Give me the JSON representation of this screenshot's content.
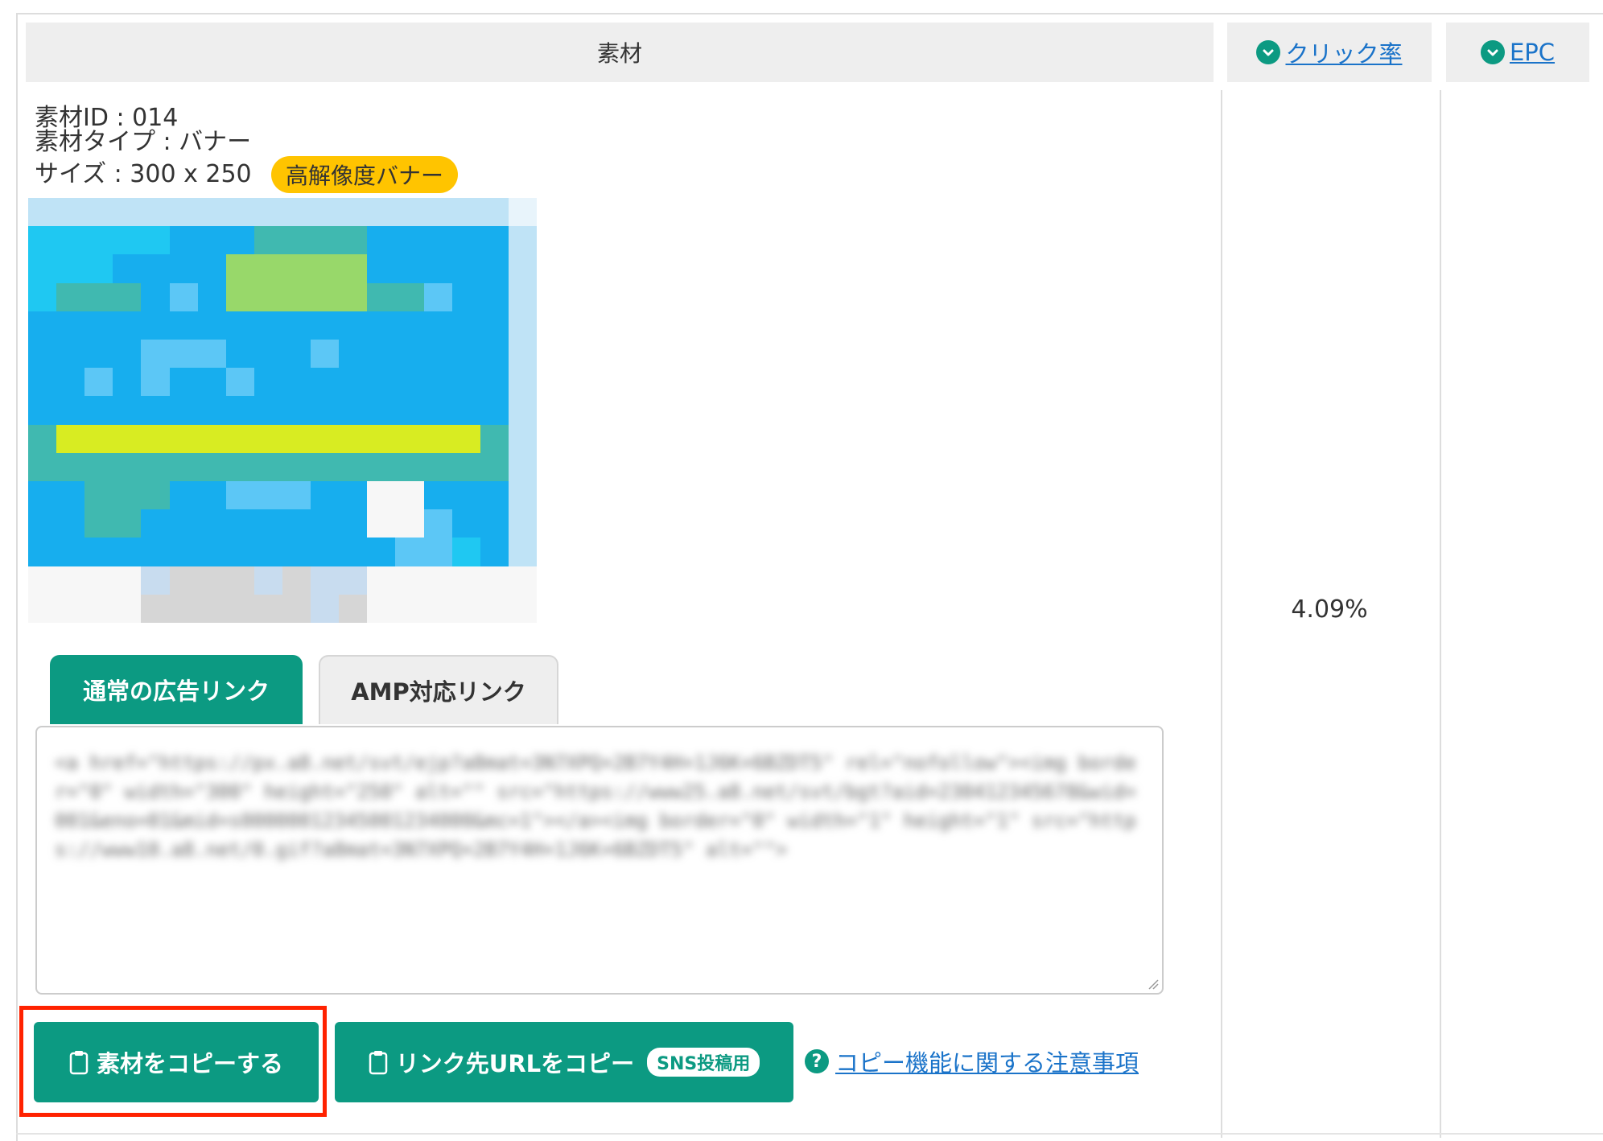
{
  "header": {
    "material_label": "素材",
    "click_rate_label": "クリック率",
    "epc_label": "EPC"
  },
  "material": {
    "id_line": "素材ID : 014",
    "type_line": "素材タイプ : バナー",
    "size_line": "サイズ : 300 x 250",
    "badge": "高解像度バナー"
  },
  "click_rate_value": "4.09%",
  "tabs": [
    {
      "label": "通常の広告リンク",
      "active": true
    },
    {
      "label": "AMP対応リンク",
      "active": false
    }
  ],
  "code_box": {
    "text": "<a href=\"https://px.a8.net/svt/ejp?a8mat=3N7XPQ+2B7Y4H+1J6K+6BZDT5\" rel=\"nofollow\"><img border=\"0\" width=\"300\" height=\"250\" alt=\"\" src=\"https://www25.a8.net/svt/bgt?aid=230412345678&wid=001&eno=01&mid=s00000012345001234000&mc=1\"></a><img border=\"0\" width=\"1\" height=\"1\" src=\"https://www10.a8.net/0.gif?a8mat=3N7XPQ+2B7Y4H+1J6K+6BZDT5\" alt=\"\">"
  },
  "buttons": {
    "copy_material": "素材をコピーする",
    "copy_url": "リンク先URLをコピー",
    "sns_badge": "SNS投稿用",
    "notice_link": "コピー機能に関する注意事項"
  },
  "icons": {
    "sort": "chevron-down-circle-icon",
    "clipboard": "clipboard-icon",
    "help": "question-circle-icon"
  },
  "colors": {
    "accent_green": "#0c9a82",
    "link_blue": "#1a73c9",
    "badge_yellow": "#ffc400",
    "highlight_red": "#ff2200",
    "header_gray": "#eeeeee"
  }
}
